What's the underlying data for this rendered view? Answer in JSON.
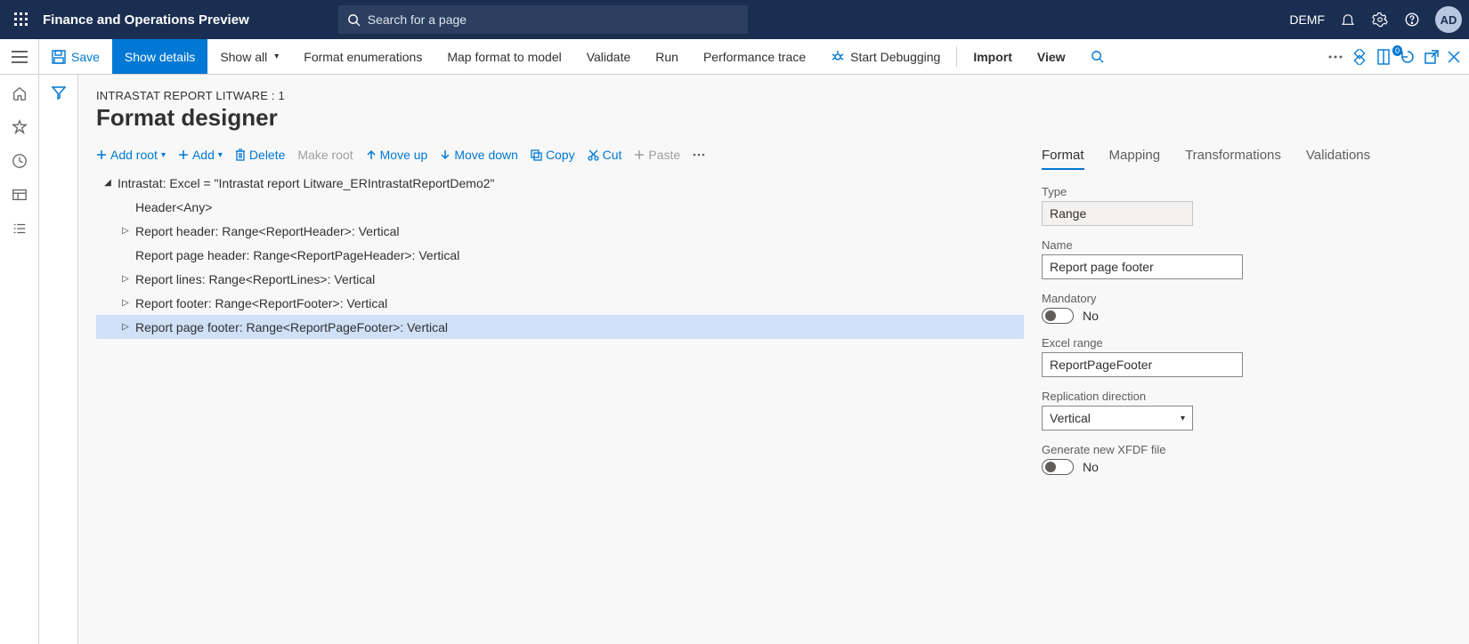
{
  "top": {
    "app_title": "Finance and Operations Preview",
    "search_placeholder": "Search for a page",
    "company": "DEMF",
    "avatar_initials": "AD"
  },
  "actionbar": {
    "save": "Save",
    "show_details": "Show details",
    "show_all": "Show all",
    "format_enum": "Format enumerations",
    "map_format": "Map format to model",
    "validate": "Validate",
    "run": "Run",
    "perf_trace": "Performance trace",
    "start_debug": "Start Debugging",
    "import": "Import",
    "view": "View",
    "badge_count": "0"
  },
  "page": {
    "breadcrumb": "INTRASTAT REPORT LITWARE : 1",
    "title": "Format designer"
  },
  "tree_toolbar": {
    "add_root": "Add root",
    "add": "Add",
    "delete": "Delete",
    "make_root": "Make root",
    "move_up": "Move up",
    "move_down": "Move down",
    "copy": "Copy",
    "cut": "Cut",
    "paste": "Paste"
  },
  "tree": {
    "root": "Intrastat: Excel = \"Intrastat report Litware_ERIntrastatReportDemo2\"",
    "items": [
      {
        "label": "Header<Any>",
        "expander": ""
      },
      {
        "label": "Report header: Range<ReportHeader>: Vertical",
        "expander": "▷"
      },
      {
        "label": "Report page header: Range<ReportPageHeader>: Vertical",
        "expander": ""
      },
      {
        "label": "Report lines: Range<ReportLines>: Vertical",
        "expander": "▷"
      },
      {
        "label": "Report footer: Range<ReportFooter>: Vertical",
        "expander": "▷"
      },
      {
        "label": "Report page footer: Range<ReportPageFooter>: Vertical",
        "expander": "▷"
      }
    ]
  },
  "tabs": {
    "format": "Format",
    "mapping": "Mapping",
    "transformations": "Transformations",
    "validations": "Validations"
  },
  "props": {
    "type_label": "Type",
    "type_value": "Range",
    "name_label": "Name",
    "name_value": "Report page footer",
    "mandatory_label": "Mandatory",
    "mandatory_value": "No",
    "excel_range_label": "Excel range",
    "excel_range_value": "ReportPageFooter",
    "replication_label": "Replication direction",
    "replication_value": "Vertical",
    "xfdf_label": "Generate new XFDF file",
    "xfdf_value": "No"
  }
}
